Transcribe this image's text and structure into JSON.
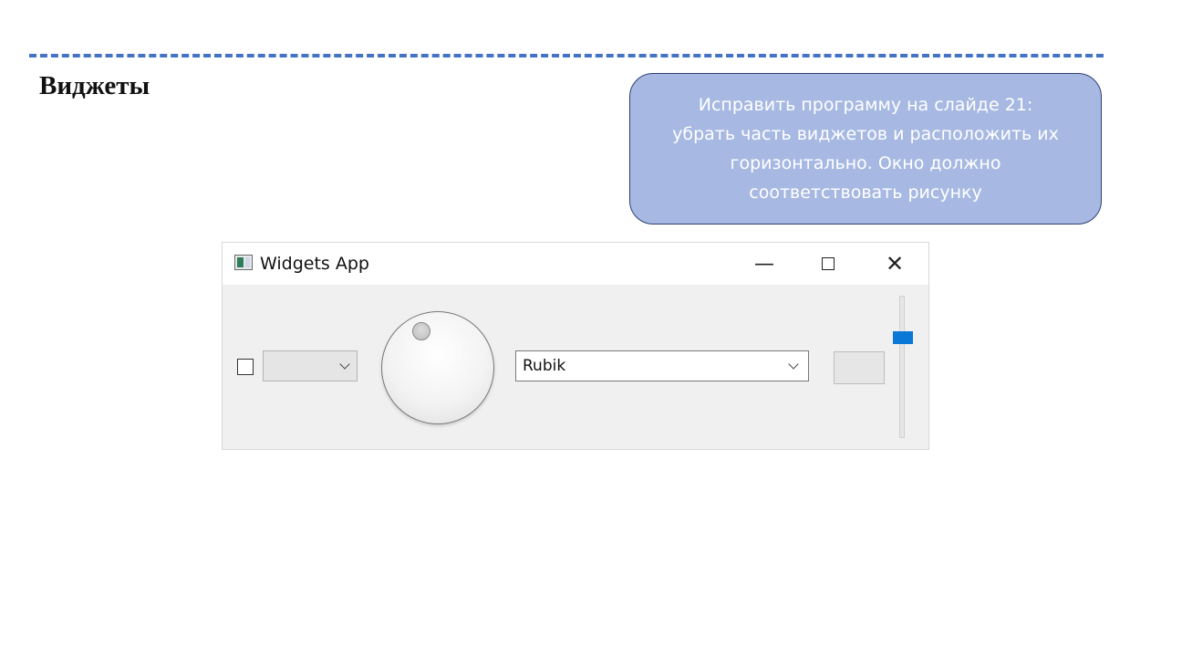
{
  "slide": {
    "title": "Виджеты"
  },
  "callout": {
    "lines": [
      "Исправить программу на слайде 21:",
      "убрать часть виджетов и расположить их",
      "горизонтально. Окно должно",
      "соответствовать рисунку"
    ]
  },
  "window": {
    "title": "Widgets App",
    "minimize_glyph": "—",
    "close_glyph": "✕",
    "icon": "qt-app-icon"
  },
  "widgets": {
    "checkbox_checked": false,
    "combo_empty_value": "",
    "font_combo_value": "Rubik",
    "spin_value": "",
    "slider_value_fraction": 0.8
  },
  "colors": {
    "dash": "#4472c4",
    "callout_bg": "#a7b9e2",
    "callout_border": "#2e3f74",
    "slider_handle": "#0a78d7"
  }
}
